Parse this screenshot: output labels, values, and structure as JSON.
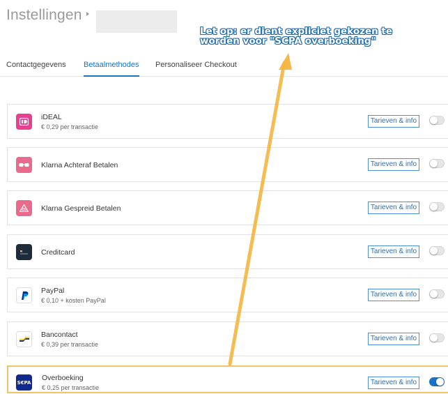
{
  "header": {
    "title": "Instellingen"
  },
  "annotation": {
    "line1": "Let op: er dient expliciet gekozen te",
    "line2": "worden voor \"SCPA overboeking\""
  },
  "tabs": [
    {
      "label": "Contactgegevens",
      "active": false
    },
    {
      "label": "Betaalmethodes",
      "active": true
    },
    {
      "label": "Personaliseer Checkout",
      "active": false
    }
  ],
  "methods": [
    {
      "name": "iDEAL",
      "sub": "€ 0,29 per transactie",
      "enabled": false,
      "logo": "ideal-icon",
      "color": "#e8408f"
    },
    {
      "name": "Klarna Achteraf Betalen",
      "sub": "",
      "enabled": false,
      "logo": "klarna-glasses-icon",
      "color": "#e96a8a"
    },
    {
      "name": "Klarna Gespreid Betalen",
      "sub": "",
      "enabled": false,
      "logo": "klarna-pyramid-icon",
      "color": "#e96a8a"
    },
    {
      "name": "Creditcard",
      "sub": "",
      "enabled": false,
      "logo": "creditcard-icon",
      "color": "#1d2b3a"
    },
    {
      "name": "PayPal",
      "sub": "€ 0,10 + kosten PayPal",
      "enabled": false,
      "logo": "paypal-icon",
      "color": "#003087"
    },
    {
      "name": "Bancontact",
      "sub": "€ 0,39 per transactie",
      "enabled": false,
      "logo": "bancontact-icon",
      "color": "#1e3764"
    },
    {
      "name": "Overboeking",
      "sub": "€ 0,25 per transactie",
      "enabled": true,
      "logo": "sepa-icon",
      "color": "#10298e",
      "logo_text": "S€PA"
    }
  ],
  "info_button_label": "Tarieven & info",
  "colors": {
    "accent": "#1a73c9",
    "highlight": "#f7c167",
    "annotation_stroke": "#1a6ab0"
  }
}
